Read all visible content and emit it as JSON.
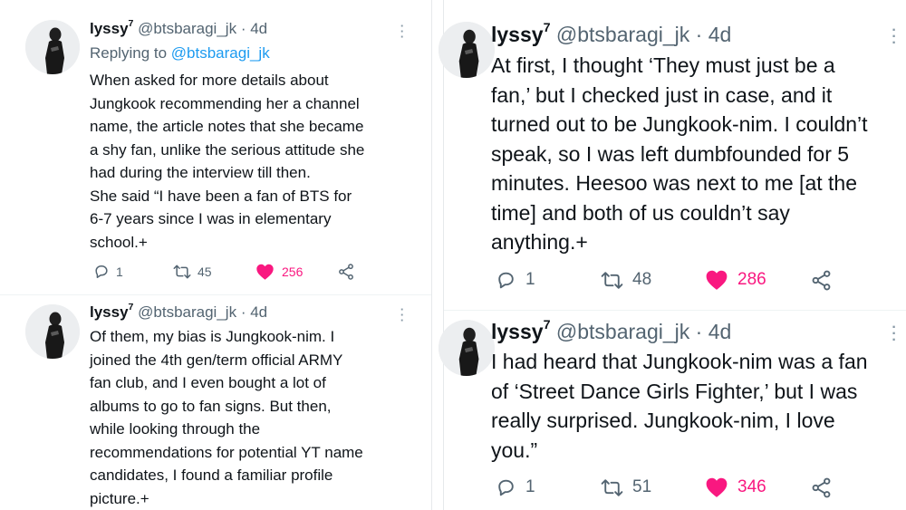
{
  "tweets": [
    {
      "display_name": "lyssy",
      "display_name_sup": "7",
      "handle": "@btsbaragi_jk",
      "separator": "·",
      "time": "4d",
      "replying_label": "Replying to ",
      "replying_handle": "@btsbaragi_jk",
      "text": "When asked for more details about\nJungkook recommending her a channel\nname, the article notes that she became\na shy fan, unlike the serious attitude she\nhad during the interview till then.\nShe said “I have been a fan of BTS for\n6-7 years since I was in elementary\nschool.+",
      "replies": "1",
      "retweets": "45",
      "likes": "256"
    },
    {
      "display_name": "lyssy",
      "display_name_sup": "7",
      "handle": "@btsbaragi_jk",
      "separator": "·",
      "time": "4d",
      "text": "Of them, my bias is Jungkook-nim. I\njoined the 4th gen/term official ARMY\nfan club, and I even bought a lot of\nalbums to go to fan signs. But then,\nwhile looking through the\nrecommendations for potential YT name\ncandidates, I found a familiar profile\npicture.+"
    },
    {
      "display_name": "lyssy",
      "display_name_sup": "7",
      "handle": "@btsbaragi_jk",
      "separator": "·",
      "time": "4d",
      "text": "At first, I thought ‘They must just be a\nfan,’ but I checked just in case, and it\nturned out to be Jungkook-nim. I couldn’t\nspeak, so I was left dumbfounded for 5\nminutes. Heesoo was next to me [at the\ntime] and both of us couldn’t say\nanything.+",
      "replies": "1",
      "retweets": "48",
      "likes": "286"
    },
    {
      "display_name": "lyssy",
      "display_name_sup": "7",
      "handle": "@btsbaragi_jk",
      "separator": "·",
      "time": "4d",
      "text": "I had heard that Jungkook-nim was a fan\nof ‘Street Dance Girls Fighter,’ but I was\nreally surprised. Jungkook-nim, I love\nyou.”",
      "replies": "1",
      "retweets": "51",
      "likes": "346"
    }
  ],
  "colors": {
    "like": "#f91880",
    "link": "#1d9bf0",
    "muted": "#536471",
    "text": "#0f1419"
  },
  "icons": [
    "reply-icon",
    "retweet-icon",
    "heart-icon",
    "share-icon",
    "more-options-icon",
    "avatar"
  ]
}
